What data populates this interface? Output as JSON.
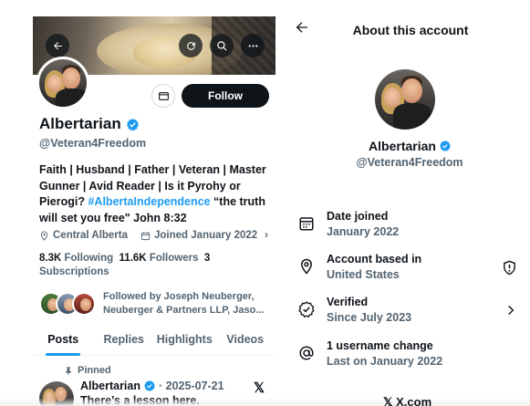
{
  "profile": {
    "display_name": "Albertarian",
    "handle": "@Veteran4Freedom",
    "bio_part1": "Faith | Husband | Father | Veteran | Master Gunner | Avid Reader | Is it Pyrohy or Pierogi? ",
    "bio_hashtag": "#AlbertaIndependence",
    "bio_part2": " “the truth will set you free\" John 8:32",
    "location": "Central Alberta",
    "joined": "Joined January 2022",
    "following_count": "8.3K",
    "following_label": "Following",
    "followers_count": "11.6K",
    "followers_label": "Followers",
    "subscriptions_count": "3",
    "subscriptions_label": "Subscriptions",
    "followed_by": "Followed by Joseph Neuberger, Neuberger & Partners LLP, Jaso...",
    "follow_label": "Follow"
  },
  "tabs": [
    {
      "label": "Posts",
      "active": true
    },
    {
      "label": "Replies",
      "active": false
    },
    {
      "label": "Highlights",
      "active": false
    },
    {
      "label": "Videos",
      "active": false
    }
  ],
  "pinned_post": {
    "pinned_label": "Pinned",
    "author": "Albertarian",
    "date": "· 2025-07-21",
    "text": "There’s a lesson here."
  },
  "about": {
    "title": "About this account",
    "name": "Albertarian",
    "handle": "@Veteran4Freedom",
    "rows": [
      {
        "label": "Date joined",
        "value": "January 2022",
        "icon": "calendar-icon"
      },
      {
        "label": "Account based in",
        "value": "United States",
        "icon": "location-pin-icon"
      },
      {
        "label": "Verified",
        "value": "Since July 2023",
        "icon": "verified-badge-icon"
      },
      {
        "label": "1 username change",
        "value": "Last on January 2022",
        "icon": "at-sign-icon"
      }
    ]
  },
  "footer": {
    "domain": "X.com"
  },
  "colors": {
    "accent": "#1d9bf0",
    "text": "#0f1419",
    "muted": "#536471"
  }
}
